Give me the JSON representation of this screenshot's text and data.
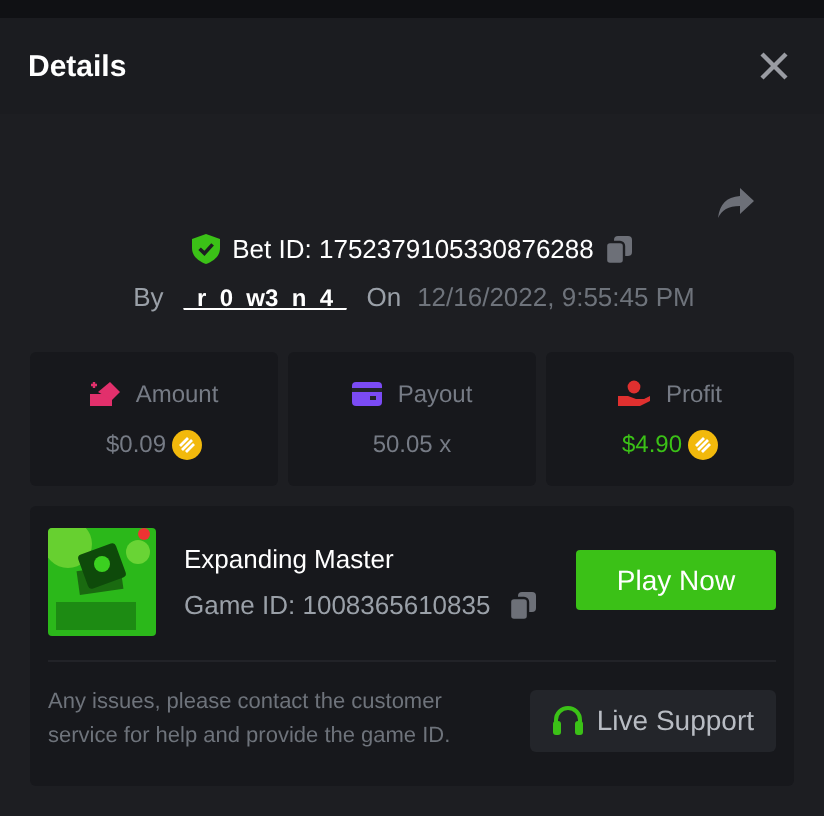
{
  "dialog": {
    "title": "Details"
  },
  "bet": {
    "label": "Bet ID:",
    "id": "1752379105330876288",
    "by_label": "By",
    "user": "_r_0_w3_n_4_",
    "on_label": "On",
    "date": "12/16/2022, 9:55:45 PM"
  },
  "stats": [
    {
      "kind": "amount",
      "label": "Amount",
      "value": "$0.09",
      "coin": true,
      "positive": false
    },
    {
      "kind": "payout",
      "label": "Payout",
      "value": "50.05 x",
      "coin": false,
      "positive": false
    },
    {
      "kind": "profit",
      "label": "Profit",
      "value": "$4.90",
      "coin": true,
      "positive": true
    }
  ],
  "game": {
    "name": "Expanding Master",
    "id_label": "Game ID:",
    "id": "1008365610835",
    "play_button": "Play Now"
  },
  "support": {
    "text": "Any issues, please contact the customer service for help and provide the game ID.",
    "button": "Live Support"
  }
}
